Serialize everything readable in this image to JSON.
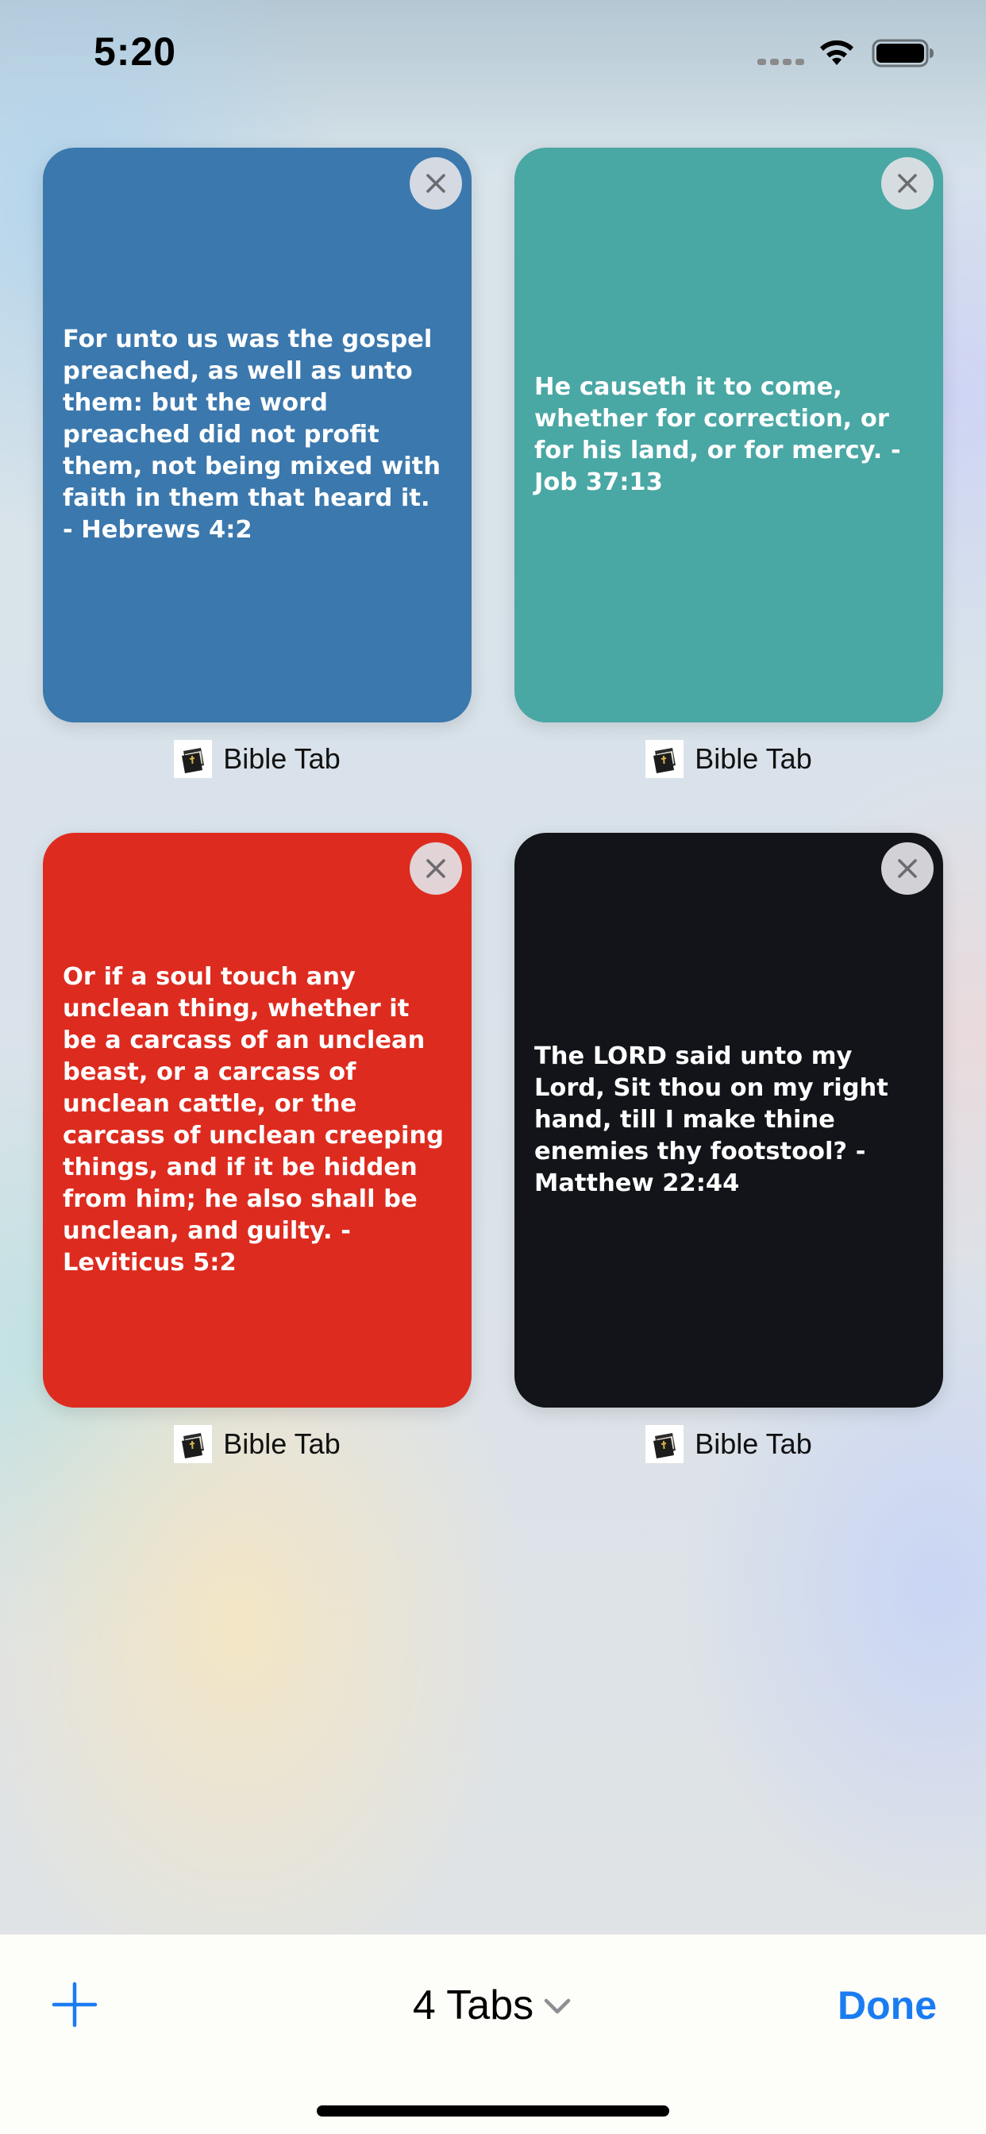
{
  "status_bar": {
    "time": "5:20"
  },
  "tabs": [
    {
      "verse": "For unto us was the gospel preached, as well as unto them: but the word preached did not profit them, not being mixed with faith in them that heard it. - Hebrews 4:2",
      "title": "Bible Tab",
      "color": "#3b78ad",
      "favicon": "bible-book-icon"
    },
    {
      "verse": "He causeth it to come, whether for correction, or for his land, or for mercy. - Job 37:13",
      "title": "Bible Tab",
      "color": "#49a7a4",
      "favicon": "bible-book-icon"
    },
    {
      "verse": "Or if a soul touch any unclean thing, whether it be a carcass of an unclean beast, or a carcass of unclean cattle, or the carcass of unclean creeping things, and if it be hidden from him; he also shall be unclean, and guilty. - Leviticus 5:2",
      "title": "Bible Tab",
      "color": "#dd2b1f",
      "favicon": "bible-book-icon"
    },
    {
      "verse": "The LORD said unto my Lord, Sit thou on my right hand, till I make thine enemies thy footstool? - Matthew 22:44",
      "title": "Bible Tab",
      "color": "#121419",
      "favicon": "bible-book-icon"
    }
  ],
  "toolbar": {
    "tabs_count_label": "4 Tabs",
    "done_label": "Done",
    "accent_color": "#1a7cf2"
  }
}
